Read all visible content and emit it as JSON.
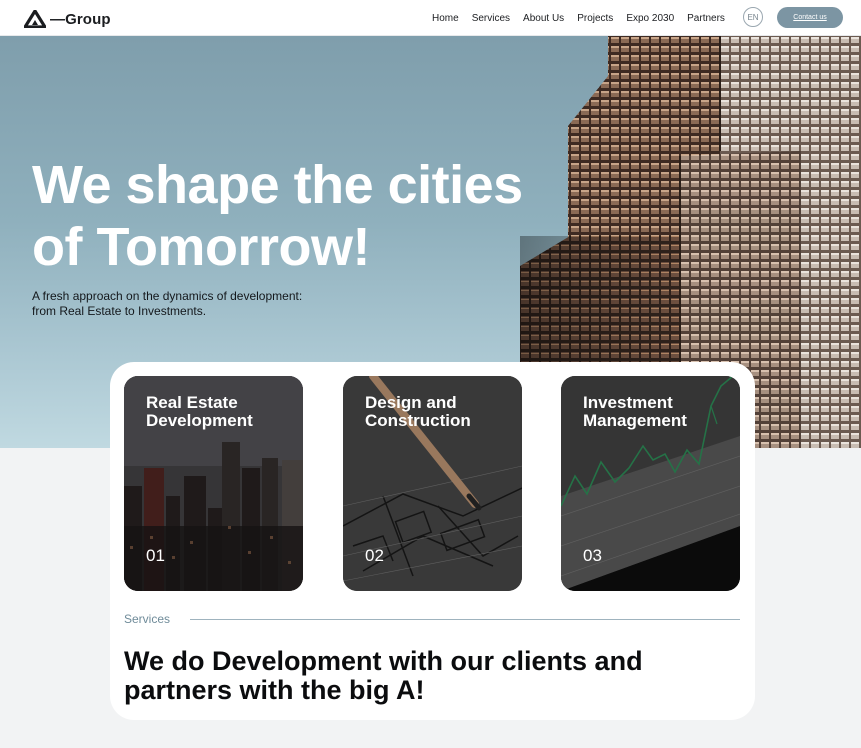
{
  "header": {
    "logo_text": "—Group",
    "nav": [
      "Home",
      "Services",
      "About Us",
      "Projects",
      "Expo 2030",
      "Partners"
    ],
    "language": "EN",
    "contact_label": "Contact us"
  },
  "hero": {
    "title_line1": "We shape the cities",
    "title_line2": "of Tomorrow!",
    "subtitle_line1": "A fresh approach on the dynamics of development:",
    "subtitle_line2": "from Real Estate to Investments."
  },
  "cards": [
    {
      "title_line1": "Real Estate",
      "title_line2": "Development",
      "number": "01",
      "image": "city-skyline"
    },
    {
      "title_line1": "Design and",
      "title_line2": "Construction",
      "number": "02",
      "image": "blueprint-with-pencil"
    },
    {
      "title_line1": "Investment",
      "title_line2": "Management",
      "number": "03",
      "image": "stock-chart"
    }
  ],
  "services": {
    "label": "Services",
    "headline_line1": "We do Development with our clients and",
    "headline_line2": "partners with the big A!"
  },
  "colors": {
    "accent": "#7c95a3",
    "hero_sky": "#8fb0bd",
    "chart_line": "#2e8b57"
  }
}
